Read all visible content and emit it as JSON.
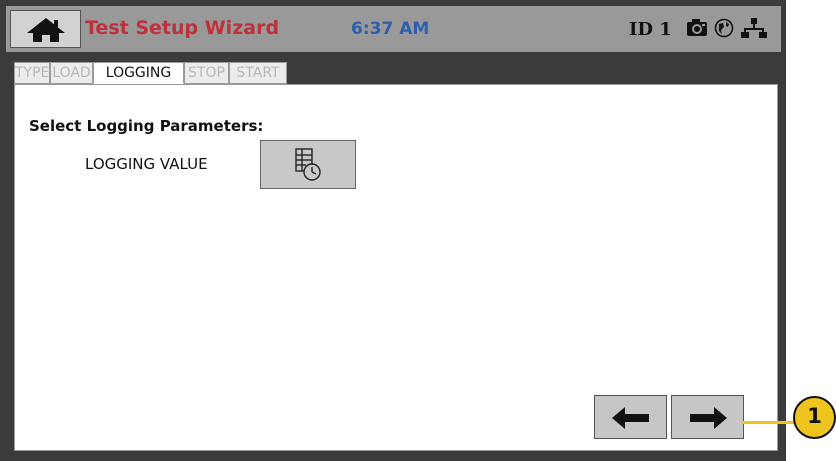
{
  "header": {
    "home_icon": "home-icon",
    "title": "Test Setup Wizard",
    "time": "6:37 AM",
    "device_id": "ID 1",
    "status_icons": [
      "camera-icon",
      "globe-icon",
      "network-icon"
    ]
  },
  "tabs": [
    {
      "label": "TYPE",
      "active": false
    },
    {
      "label": "LOAD",
      "active": false
    },
    {
      "label": "LOGGING",
      "active": true
    },
    {
      "label": "STOP",
      "active": false
    },
    {
      "label": "START",
      "active": false
    }
  ],
  "main": {
    "heading": "Select Logging Parameters:",
    "field_label": "LOGGING VALUE",
    "field_button_icon": "logging-timer-icon"
  },
  "nav": {
    "back_icon": "arrow-left-icon",
    "next_icon": "arrow-right-icon"
  },
  "callout": {
    "number": "1",
    "color": "#f0c41e"
  },
  "colors": {
    "title": "#c0303a",
    "time": "#2e5fae",
    "header_bar": "#999999",
    "frame": "#3b3b3b"
  }
}
